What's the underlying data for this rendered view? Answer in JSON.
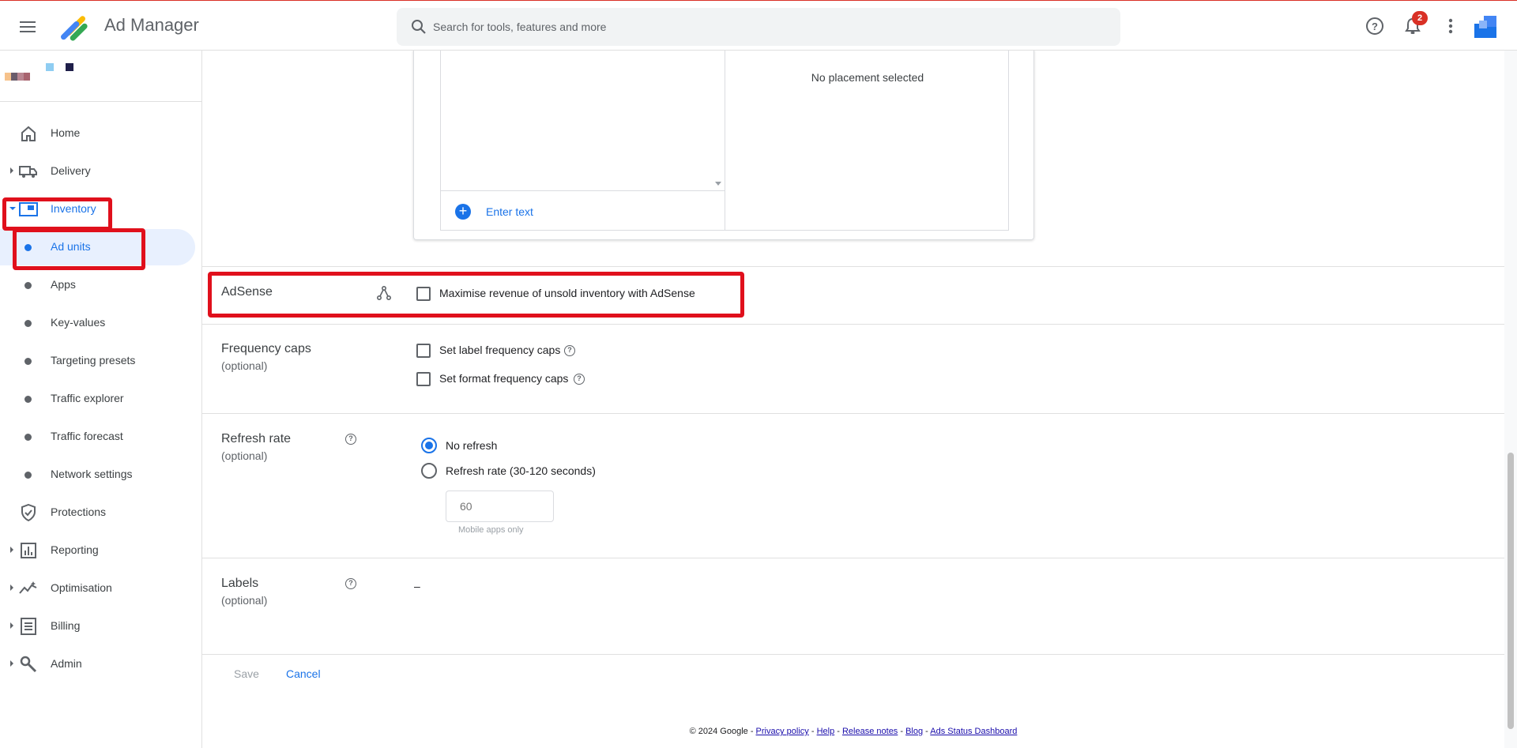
{
  "app": {
    "title": "Ad Manager"
  },
  "search": {
    "placeholder": "Search for tools, features and more"
  },
  "header": {
    "notification_count": "2"
  },
  "sidebar": {
    "items": [
      {
        "label": "Home"
      },
      {
        "label": "Delivery"
      },
      {
        "label": "Inventory"
      },
      {
        "label": "Ad units"
      },
      {
        "label": "Apps"
      },
      {
        "label": "Key-values"
      },
      {
        "label": "Targeting presets"
      },
      {
        "label": "Traffic explorer"
      },
      {
        "label": "Traffic forecast"
      },
      {
        "label": "Network settings"
      },
      {
        "label": "Protections"
      },
      {
        "label": "Reporting"
      },
      {
        "label": "Optimisation"
      },
      {
        "label": "Billing"
      },
      {
        "label": "Admin"
      }
    ]
  },
  "placement": {
    "empty_message": "No placement selected",
    "enter_text_label": "Enter text"
  },
  "adsense": {
    "title": "AdSense",
    "checkbox_label": "Maximise revenue of unsold inventory with AdSense",
    "checked": false
  },
  "frequency_caps": {
    "title": "Frequency caps",
    "subtitle": "(optional)",
    "label_caps": "Set label frequency caps",
    "format_caps": "Set format frequency caps"
  },
  "refresh_rate": {
    "title": "Refresh rate",
    "subtitle": "(optional)",
    "options": [
      "No refresh",
      "Refresh rate (30-120 seconds)"
    ],
    "selected": "No refresh",
    "input_placeholder": "60",
    "hint": "Mobile apps only"
  },
  "labels": {
    "title": "Labels",
    "subtitle": "(optional)",
    "value": "–"
  },
  "actions": {
    "save": "Save",
    "cancel": "Cancel"
  },
  "footer": {
    "copyright": "© 2024 Google - ",
    "links": [
      "Privacy policy",
      "Help",
      "Release notes",
      "Blog",
      "Ads Status Dashboard"
    ]
  },
  "colors": {
    "accent": "#1a73e8",
    "highlight": "#e0101c",
    "active_bg": "#e8f0fe",
    "badge": "#d93025"
  }
}
